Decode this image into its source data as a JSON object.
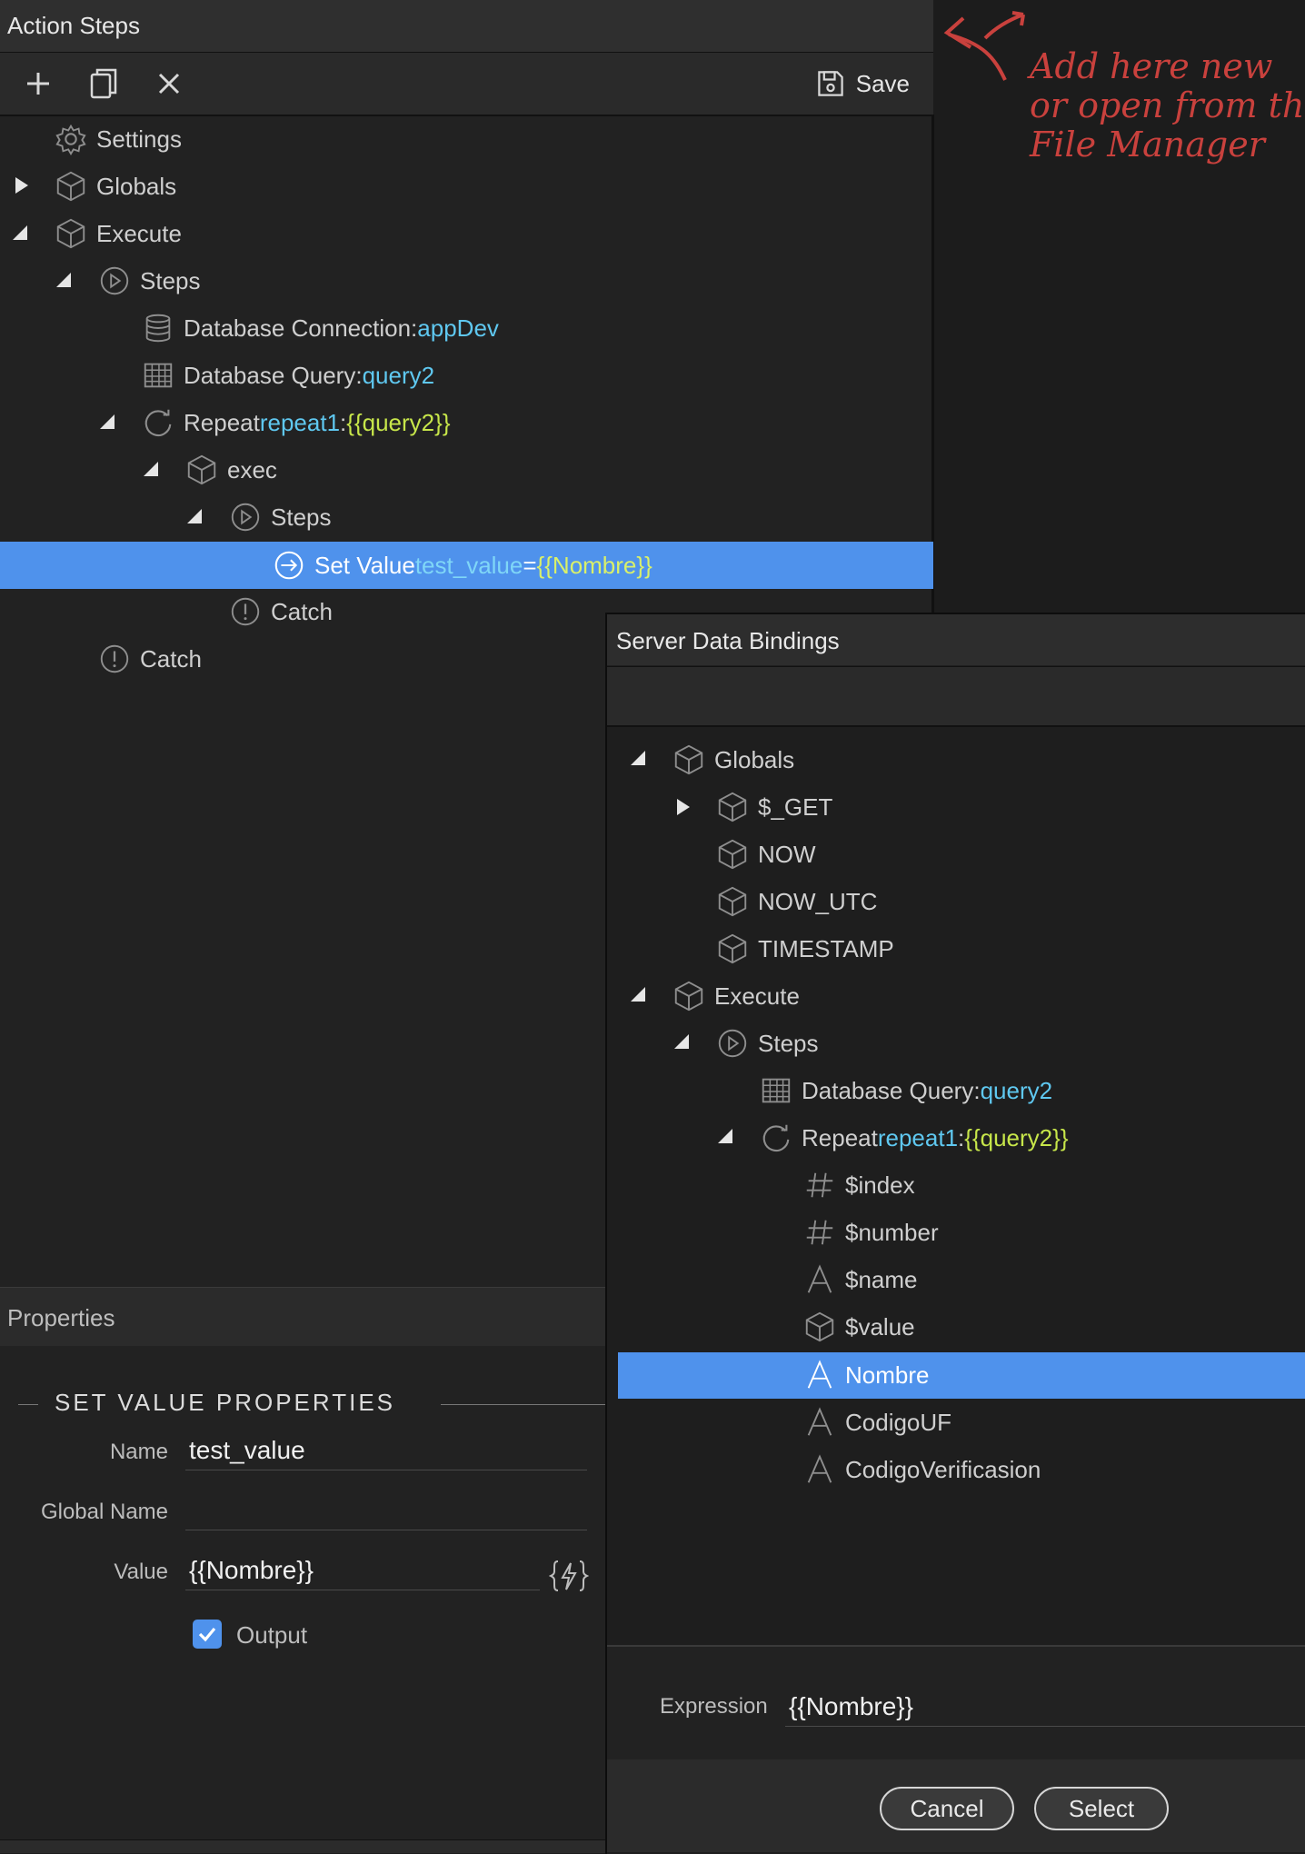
{
  "action_steps": {
    "title": "Action Steps",
    "save_label": "Save",
    "tree": {
      "settings": "Settings",
      "globals": "Globals",
      "execute": "Execute",
      "steps": "Steps",
      "db_conn_label": "Database Connection: ",
      "db_conn_value": "appDev",
      "db_query_label": "Database Query: ",
      "db_query_value": "query2",
      "repeat_label": "Repeat ",
      "repeat_name": "repeat1",
      "repeat_colon": ": ",
      "repeat_expr": "{{query2}}",
      "exec": "exec",
      "inner_steps": "Steps",
      "set_value_label": "Set Value ",
      "set_value_name": "test_value",
      "set_value_eq": " = ",
      "set_value_expr": "{{Nombre}}",
      "inner_catch": "Catch",
      "outer_catch": "Catch"
    }
  },
  "annotation": {
    "text": "Add here new\nor open from th\nFile Manager",
    "color": "#c9413d"
  },
  "properties": {
    "title": "Properties",
    "section": "SET VALUE PROPERTIES",
    "name_label": "Name",
    "name_value": "test_value",
    "global_name_label": "Global Name",
    "global_name_value": "",
    "value_label": "Value",
    "value_value": "{{Nombre}}",
    "output_label": "Output",
    "output_checked": true
  },
  "bindings_dialog": {
    "title": "Server Data Bindings",
    "tree": {
      "globals": "Globals",
      "get": "$_GET",
      "now": "NOW",
      "now_utc": "NOW_UTC",
      "timestamp": "TIMESTAMP",
      "execute": "Execute",
      "steps": "Steps",
      "db_query_label": "Database Query: ",
      "db_query_value": "query2",
      "repeat_label": "Repeat ",
      "repeat_name": "repeat1",
      "repeat_colon": ": ",
      "repeat_expr": "{{query2}}",
      "index": "$index",
      "number": "$number",
      "name": "$name",
      "value": "$value",
      "nombre": "Nombre",
      "codigo_uf": "CodigoUF",
      "codigo_verif": "CodigoVerificasion"
    },
    "expression_label": "Expression",
    "expression_value": "{{Nombre}}",
    "cancel_label": "Cancel",
    "select_label": "Select"
  },
  "colors": {
    "selection": "#4f92ec",
    "binding_name": "#5fc8f0",
    "binding_expr": "#c7e64a"
  }
}
